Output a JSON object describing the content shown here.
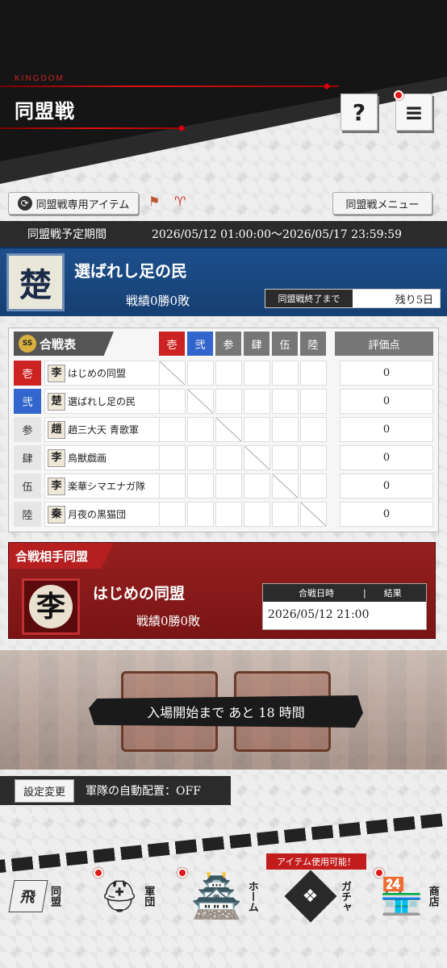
{
  "header": {
    "brand": "KINGDOM",
    "title": "同盟戦",
    "help_label": "?",
    "menu_label": "≡"
  },
  "toolbar": {
    "items_button": "同盟戦専用アイテム",
    "menu_button": "同盟戦メニュー"
  },
  "period": {
    "label": "同盟戦予定期間",
    "range": "2026/05/12 01:00:00〜2026/05/17 23:59:59"
  },
  "alliance": {
    "emblem": "楚",
    "name": "選ばれし足の民",
    "record": "戦績0勝0敗",
    "remaining_label": "同盟戦終了まで",
    "remaining_value": "残り5日"
  },
  "battle_table": {
    "badge": "SS",
    "title": "合戦表",
    "columns": [
      "壱",
      "弐",
      "参",
      "肆",
      "伍",
      "陸"
    ],
    "score_header": "評価点",
    "rows": [
      {
        "num": "壱",
        "emblem": "李",
        "name": "はじめの同盟",
        "score": "0"
      },
      {
        "num": "弐",
        "emblem": "楚",
        "name": "選ばれし足の民",
        "score": "0"
      },
      {
        "num": "参",
        "emblem": "趙",
        "name": "趙三大天 青歌軍",
        "score": "0"
      },
      {
        "num": "肆",
        "emblem": "李",
        "name": "鳥獣戯画",
        "score": "0"
      },
      {
        "num": "伍",
        "emblem": "李",
        "name": "楽華シマエナガ隊",
        "score": "0"
      },
      {
        "num": "陸",
        "emblem": "秦",
        "name": "月夜の黒猫団",
        "score": "0"
      }
    ]
  },
  "opponent": {
    "heading": "合戦相手同盟",
    "emblem": "李",
    "name": "はじめの同盟",
    "record": "戦績0勝0敗",
    "datetime_label": "合戦日時",
    "result_label": "結果",
    "datetime": "2026/05/12 21:00"
  },
  "entry": {
    "countdown": "入場開始まで あと 18 時間"
  },
  "settings": {
    "button": "設定変更",
    "auto_deploy": "軍隊の自動配置：OFF"
  },
  "nav": {
    "item_notice": "アイテム使用可能！",
    "items": [
      {
        "label": "同盟",
        "icon": "flag-icon",
        "glyph": "飛"
      },
      {
        "label": "軍団",
        "icon": "helmet-icon",
        "glyph": "⛑"
      },
      {
        "label": "ホーム",
        "icon": "castle-icon",
        "glyph": "🏯"
      },
      {
        "label": "ガチャ",
        "icon": "gacha-icon",
        "glyph": "❖"
      },
      {
        "label": "商店",
        "icon": "shop-icon",
        "glyph": "🏪"
      }
    ]
  },
  "colors": {
    "accent_red": "#c21c1c",
    "alliance_blue": "#1d4f8c",
    "dark": "#2b2b2b"
  }
}
